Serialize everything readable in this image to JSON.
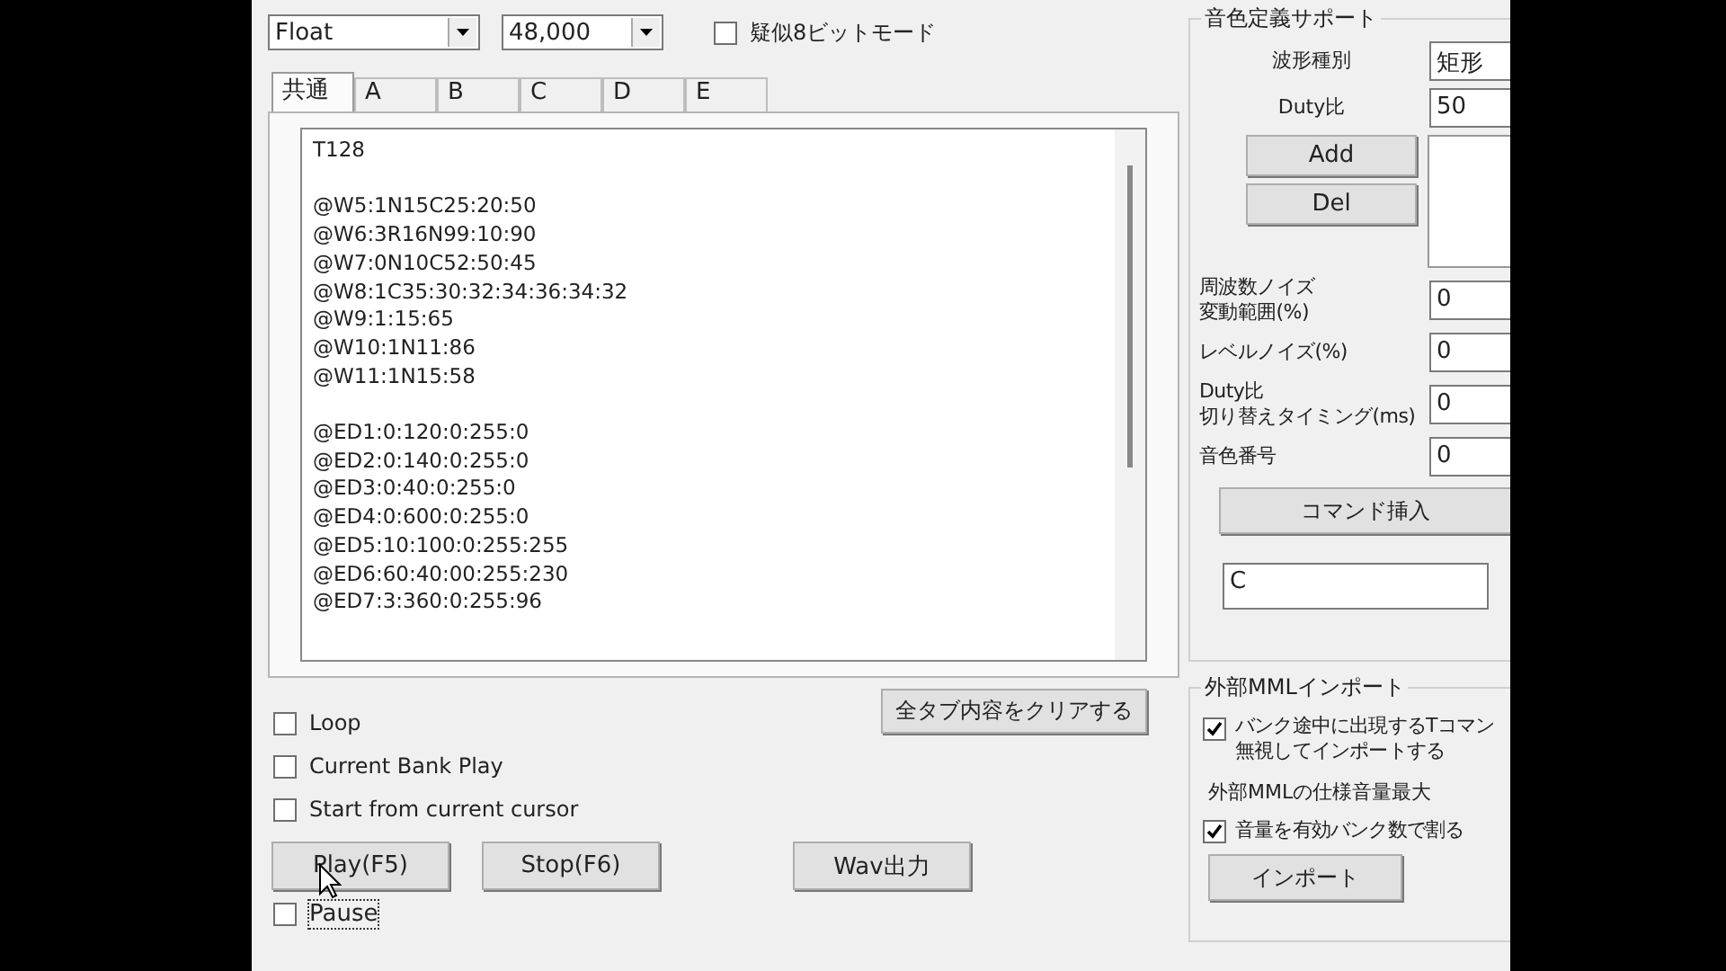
{
  "format_select": {
    "value": "Float"
  },
  "rate_select": {
    "value": "48,000"
  },
  "pseudo_8bit": {
    "label": "疑似8ビットモード",
    "checked": false
  },
  "tabs": [
    {
      "label": "共通",
      "selected": true
    },
    {
      "label": "A",
      "selected": false
    },
    {
      "label": "B",
      "selected": false
    },
    {
      "label": "C",
      "selected": false
    },
    {
      "label": "D",
      "selected": false
    },
    {
      "label": "E",
      "selected": false
    }
  ],
  "editor": {
    "blocks": [
      [
        "T128"
      ],
      [
        "@W5:1N15C25:20:50",
        "@W6:3R16N99:10:90",
        "@W7:0N10C52:50:45",
        "@W8:1C35:30:32:34:36:34:32",
        "@W9:1:15:65",
        "@W10:1N11:86",
        "@W11:1N15:58"
      ],
      [
        "@ED1:0:120:0:255:0",
        "@ED2:0:140:0:255:0",
        "@ED3:0:40:0:255:0",
        "@ED4:0:600:0:255:0",
        "@ED5:10:100:0:255:255",
        "@ED6:60:40:00:255:230",
        "@ED7:3:360:0:255:96"
      ]
    ]
  },
  "clear_button": "全タブ内容をクリアする",
  "options": [
    {
      "label": "Loop",
      "checked": false
    },
    {
      "label": "Current Bank Play",
      "checked": false
    },
    {
      "label": "Start from current cursor",
      "checked": false
    }
  ],
  "play_button": "Play(F5)",
  "stop_button": "Stop(F6)",
  "wav_button": "Wav出力",
  "pause": {
    "label": "Pause",
    "checked": false,
    "focused": true
  },
  "tone_support": {
    "title": "音色定義サポート",
    "waveform_label": "波形種別",
    "waveform_value": "矩形",
    "duty_label": "Duty比",
    "duty_value": "50",
    "add_button": "Add",
    "del_button": "Del",
    "fields": [
      {
        "label_lines": [
          "周波数ノイズ",
          "変動範囲(%)"
        ],
        "value": "0"
      },
      {
        "label_lines": [
          "レベルノイズ(%)"
        ],
        "value": "0"
      },
      {
        "label_lines": [
          "Duty比",
          "切り替えタイミング(ms)"
        ],
        "value": "0"
      },
      {
        "label_lines": [
          "音色番号"
        ],
        "value": "0"
      }
    ],
    "insert_button": "コマンド挿入",
    "command_value": "C"
  },
  "mml_import": {
    "title": "外部MMLインポート",
    "ignore_t": {
      "label_lines": [
        "バンク途中に出現するTコマン",
        "無視してインポートする"
      ],
      "checked": true
    },
    "max_volume_label": "外部MMLの仕様音量最大",
    "divide": {
      "label": "音量を有効バンク数で割る",
      "checked": true
    },
    "import_button": "インポート"
  }
}
